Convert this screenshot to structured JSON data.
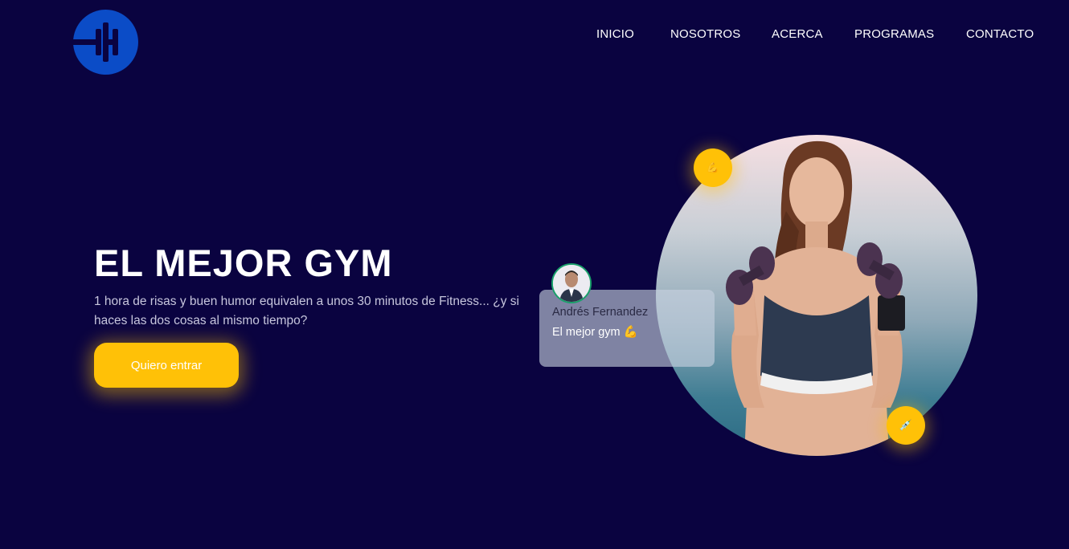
{
  "header": {
    "logo_icon": "dumbbell-icon",
    "nav": [
      {
        "label": "INICIO"
      },
      {
        "label": "NOSOTROS"
      },
      {
        "label": "ACERCA"
      },
      {
        "label": "PROGRAMAS"
      },
      {
        "label": "CONTACTO"
      }
    ]
  },
  "hero": {
    "title": "EL MEJOR GYM",
    "text": "1 hora de risas y buen humor equivalen a unos 30 minutos de Fitness... ¿y si haces las dos cosas al mismo tiempo?",
    "cta_label": "Quiero entrar"
  },
  "testimonial": {
    "name": "Andrés Fernandez",
    "text": "El mejor gym 💪"
  },
  "badges": {
    "top": "💪",
    "bottom": "💉"
  },
  "colors": {
    "background": "#0a0340",
    "accent": "#ffc107",
    "logo": "#0b4cc7"
  }
}
